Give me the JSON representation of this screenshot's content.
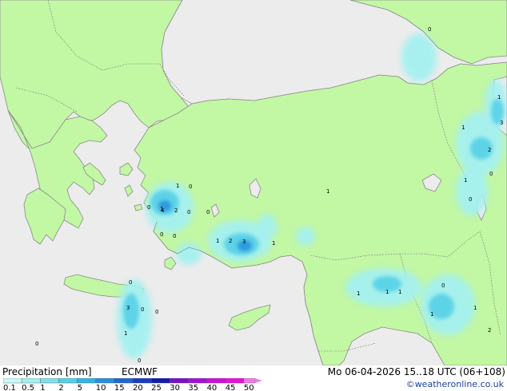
{
  "title": "Precipitation [mm]",
  "model": "ECMWF",
  "valid_time": "Mo 06-04-2026 15..18 UTC (06+108)",
  "credit": "©weatheronline.co.uk",
  "colors": {
    "sea": "#ececec",
    "land": "#c2f7a4",
    "coast": "#8a8a8a",
    "border": "#7a7a7a"
  },
  "scale": {
    "labels": [
      "0.1",
      "0.5",
      "1",
      "2",
      "5",
      "10",
      "15",
      "20",
      "25",
      "30",
      "35",
      "40",
      "45",
      "50"
    ],
    "colors": [
      "#c8f8f8",
      "#a4f0f0",
      "#7ee0ef",
      "#55cfe8",
      "#35b4e3",
      "#2890dc",
      "#2266d0",
      "#1a3ec2",
      "#121ea8",
      "#7a10c8",
      "#a510d8",
      "#cc10d8",
      "#e812d8",
      "#f07ae8"
    ]
  },
  "value_labels": [
    "0",
    "1",
    "1",
    "3",
    "2",
    "0",
    "1",
    "0",
    "1",
    "0",
    "1",
    "0",
    "1",
    "0",
    "4",
    "2",
    "0",
    "0",
    "0",
    "1",
    "2",
    "3",
    "1",
    "0",
    "1",
    "1",
    "1",
    "0",
    "1",
    "3",
    "1",
    "2",
    "0",
    "1",
    "0",
    "0",
    "0"
  ]
}
